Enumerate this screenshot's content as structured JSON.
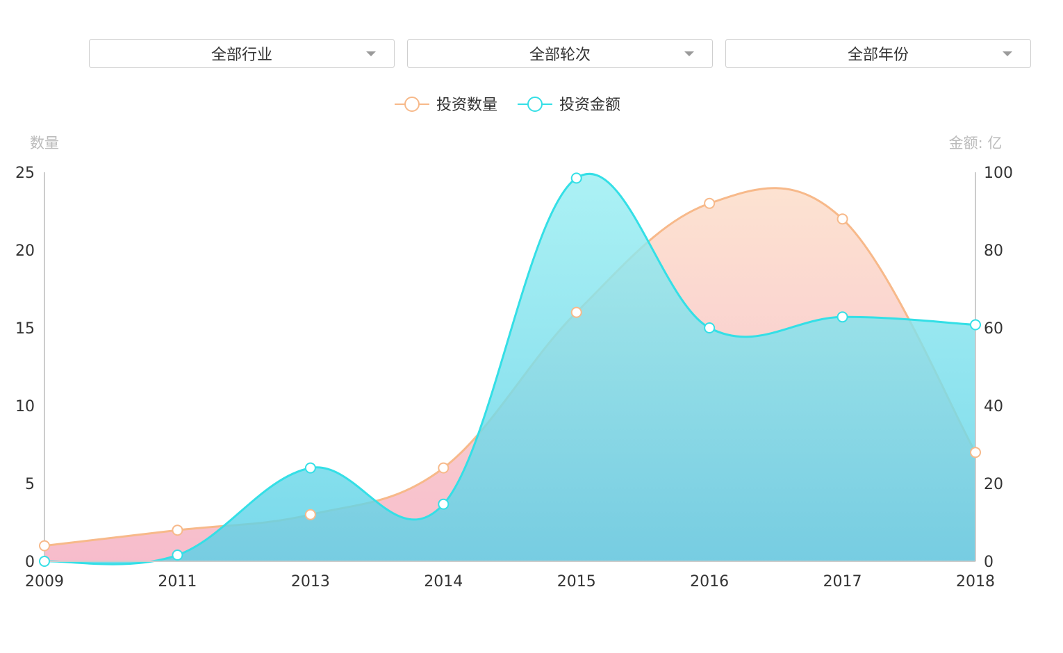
{
  "filters": {
    "industry": "全部行业",
    "round": "全部轮次",
    "year": "全部年份"
  },
  "colors": {
    "count_line": "#f7b98a",
    "count_fill_top": "#fcd9c2",
    "count_fill_bottom": "#f4a6bb",
    "amount_line": "#34dfe6",
    "amount_fill_top": "#9aeef2",
    "amount_fill_bottom": "#5ad0e6",
    "axis": "#cccccc",
    "tick_text": "#333333",
    "axis_name": "#bbbbbb"
  },
  "chart_data": {
    "type": "area",
    "categories": [
      "2009",
      "2011",
      "2013",
      "2014",
      "2015",
      "2016",
      "2017",
      "2018"
    ],
    "series": [
      {
        "name": "投资数量",
        "axis": "left",
        "values": [
          1,
          2,
          3,
          6,
          16,
          23,
          22,
          7
        ]
      },
      {
        "name": "投资金额",
        "axis": "right",
        "values": [
          0,
          1.6,
          24,
          14.7,
          98.5,
          60,
          62.8,
          60.8
        ]
      }
    ],
    "y_left": {
      "label": "数量",
      "ylim": [
        0,
        25
      ],
      "ticks": [
        "0",
        "5",
        "10",
        "15",
        "20",
        "25"
      ]
    },
    "y_right": {
      "label": "金额: 亿",
      "ylim": [
        0,
        100
      ],
      "ticks": [
        "0",
        "20",
        "40",
        "60",
        "80",
        "100"
      ]
    },
    "legend": "top-center",
    "grid": false,
    "smooth": true
  }
}
